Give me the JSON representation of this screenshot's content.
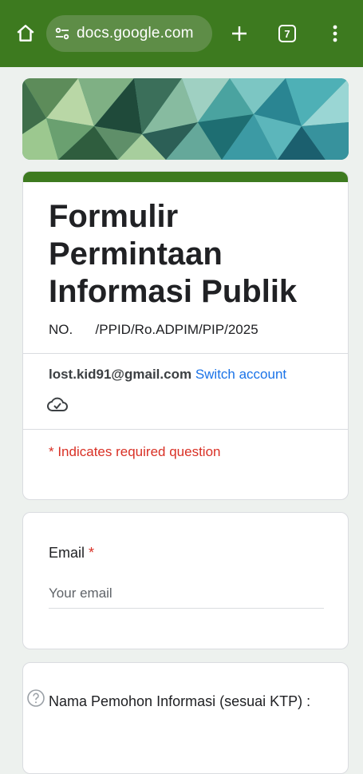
{
  "browser": {
    "url": "docs.google.com",
    "tab_count": "7",
    "icons": {
      "home": "home-icon",
      "site_settings": "tune-icon",
      "new_tab": "plus-icon",
      "menu": "more-vert-icon"
    }
  },
  "form": {
    "title": "Formulir Permintaan Informasi Publik",
    "description": "NO.      /PPID/Ro.ADPIM/PIP/2025",
    "account_email": "lost.kid91@gmail.com",
    "switch_account": "Switch account",
    "saved_icon": "cloud-done-icon",
    "required_note": "* Indicates required question",
    "accent_color": "#3d7a1f"
  },
  "questions": [
    {
      "label": "Email",
      "required_mark": "*",
      "placeholder": "Your email",
      "value": ""
    },
    {
      "label": "Nama Pemohon Informasi (sesuai KTP) :",
      "help_icon": "help-circle-icon"
    }
  ]
}
